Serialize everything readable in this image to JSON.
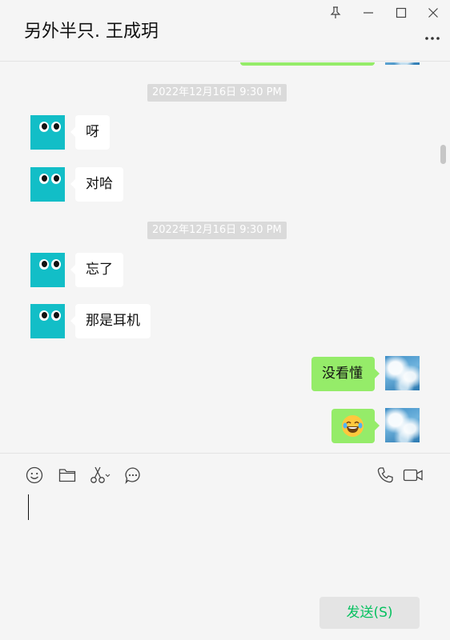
{
  "header": {
    "title": "另外半只. 王成玥",
    "pin_icon": "pin-icon",
    "minimize_icon": "minimize-icon",
    "maximize_icon": "maximize-icon",
    "close_icon": "close-icon",
    "more_icon": "more-options-icon"
  },
  "messages": {
    "timestamps": [
      "2022年12月16日 9:30 PM",
      "2022年12月16日 9:30 PM"
    ],
    "incoming": [
      {
        "text": "呀"
      },
      {
        "text": "对哈"
      },
      {
        "text": "忘了"
      },
      {
        "text": "那是耳机"
      }
    ],
    "outgoing": [
      {
        "text": "没看懂"
      },
      {
        "text": "😂",
        "icon": "tears-of-joy-emoji"
      }
    ]
  },
  "toolbar": {
    "left_tools": [
      "emoji-icon",
      "folder-icon",
      "screenshot-scissors-icon",
      "chat-history-icon"
    ],
    "right_tools": [
      "voice-call-icon",
      "video-call-icon"
    ]
  },
  "input": {
    "value": ""
  },
  "send_button": {
    "label": "发送(S)"
  },
  "colors": {
    "outgoing_bubble": "#95ec69",
    "incoming_bubble": "#ffffff",
    "avatar_teal": "#12bec7",
    "send_text": "#07c160"
  }
}
